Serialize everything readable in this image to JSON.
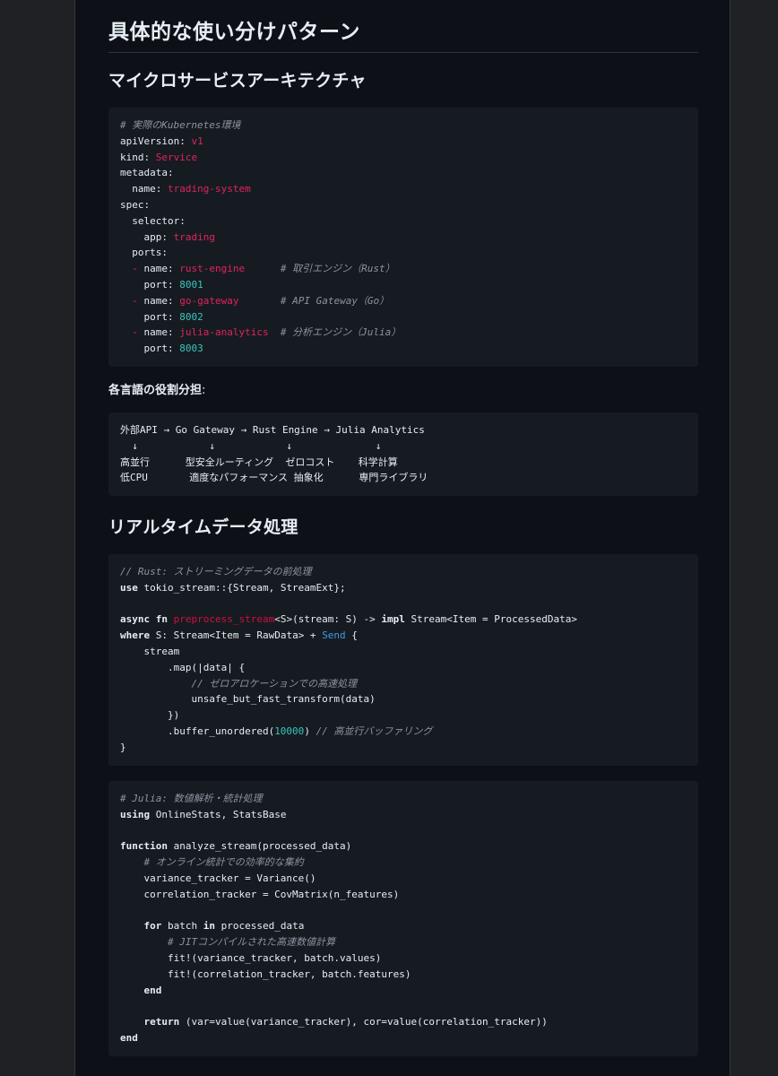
{
  "headings": {
    "h1": "具体的な使い分けパターン",
    "microservices": "マイクロサービスアーキテクチャ",
    "realtime": "リアルタイムデータ処理"
  },
  "roles_label": "各言語の役割分担",
  "roles_label_suffix": ":",
  "code_blocks": [
    {
      "id": "k8s",
      "lines": [
        [
          {
            "t": "cm",
            "v": "# 実際のKubernetes環境"
          }
        ],
        [
          {
            "t": "plain",
            "v": "apiVersion: "
          },
          {
            "t": "str",
            "v": "v1"
          }
        ],
        [
          {
            "t": "plain",
            "v": "kind: "
          },
          {
            "t": "str",
            "v": "Service"
          }
        ],
        [
          {
            "t": "plain",
            "v": "metadata:"
          }
        ],
        [
          {
            "t": "plain",
            "v": "  name: "
          },
          {
            "t": "str",
            "v": "trading-system"
          }
        ],
        [
          {
            "t": "plain",
            "v": "spec:"
          }
        ],
        [
          {
            "t": "plain",
            "v": "  selector:"
          }
        ],
        [
          {
            "t": "plain",
            "v": "    app: "
          },
          {
            "t": "str",
            "v": "trading"
          }
        ],
        [
          {
            "t": "plain",
            "v": "  ports:"
          }
        ],
        [
          {
            "t": "dash",
            "v": "  - "
          },
          {
            "t": "plain",
            "v": "name: "
          },
          {
            "t": "str",
            "v": "rust-engine"
          },
          {
            "t": "plain",
            "v": "      "
          },
          {
            "t": "cm",
            "v": "# 取引エンジン（Rust）"
          }
        ],
        [
          {
            "t": "plain",
            "v": "    port: "
          },
          {
            "t": "num",
            "v": "8001"
          }
        ],
        [
          {
            "t": "dash",
            "v": "  - "
          },
          {
            "t": "plain",
            "v": "name: "
          },
          {
            "t": "str",
            "v": "go-gateway"
          },
          {
            "t": "plain",
            "v": "       "
          },
          {
            "t": "cm",
            "v": "# API Gateway（Go）"
          }
        ],
        [
          {
            "t": "plain",
            "v": "    port: "
          },
          {
            "t": "num",
            "v": "8002"
          }
        ],
        [
          {
            "t": "dash",
            "v": "  - "
          },
          {
            "t": "plain",
            "v": "name: "
          },
          {
            "t": "str",
            "v": "julia-analytics"
          },
          {
            "t": "plain",
            "v": "  "
          },
          {
            "t": "cm",
            "v": "# 分析エンジン（Julia）"
          }
        ],
        [
          {
            "t": "plain",
            "v": "    port: "
          },
          {
            "t": "num",
            "v": "8003"
          }
        ]
      ]
    },
    {
      "id": "roles",
      "lines": [
        [
          {
            "t": "plain",
            "v": "外部API → Go Gateway → Rust Engine → Julia Analytics"
          }
        ],
        [
          {
            "t": "plain",
            "v": "  ↓            ↓            ↓              ↓"
          }
        ],
        [
          {
            "t": "plain",
            "v": "高並行      型安全ルーティング  ゼロコスト    科学計算"
          }
        ],
        [
          {
            "t": "plain",
            "v": "低CPU       適度なパフォーマンス 抽象化      専門ライブラリ"
          }
        ]
      ]
    },
    {
      "id": "rust",
      "lines": [
        [
          {
            "t": "cm",
            "v": "// Rust: ストリーミングデータの前処理"
          }
        ],
        [
          {
            "t": "kw",
            "v": "use"
          },
          {
            "t": "plain",
            "v": " tokio_stream::{Stream, StreamExt};"
          }
        ],
        [],
        [
          {
            "t": "kw",
            "v": "async fn"
          },
          {
            "t": "plain",
            "v": " "
          },
          {
            "t": "fn",
            "v": "preprocess_stream"
          },
          {
            "t": "plain",
            "v": "<S>(stream: S) -> "
          },
          {
            "t": "kw",
            "v": "impl"
          },
          {
            "t": "plain",
            "v": " Stream<Item = ProcessedData>"
          }
        ],
        [
          {
            "t": "kw",
            "v": "where"
          },
          {
            "t": "plain",
            "v": " S: Stream<Item = RawData> + "
          },
          {
            "t": "sv",
            "v": "Send"
          },
          {
            "t": "plain",
            "v": " {"
          }
        ],
        [
          {
            "t": "plain",
            "v": "    stream"
          }
        ],
        [
          {
            "t": "plain",
            "v": "        .map(|data| {"
          }
        ],
        [
          {
            "t": "plain",
            "v": "            "
          },
          {
            "t": "cm",
            "v": "// ゼロアロケーションでの高速処理"
          }
        ],
        [
          {
            "t": "plain",
            "v": "            unsafe_but_fast_transform(data)"
          }
        ],
        [
          {
            "t": "plain",
            "v": "        })"
          }
        ],
        [
          {
            "t": "plain",
            "v": "        .buffer_unordered("
          },
          {
            "t": "num",
            "v": "10000"
          },
          {
            "t": "plain",
            "v": ") "
          },
          {
            "t": "cm",
            "v": "// 高並行バッファリング"
          }
        ],
        [
          {
            "t": "plain",
            "v": "}"
          }
        ]
      ]
    },
    {
      "id": "julia",
      "lines": [
        [
          {
            "t": "cm",
            "v": "# Julia: 数値解析・統計処理"
          }
        ],
        [
          {
            "t": "kw",
            "v": "using"
          },
          {
            "t": "plain",
            "v": " OnlineStats, StatsBase"
          }
        ],
        [],
        [
          {
            "t": "kw",
            "v": "function"
          },
          {
            "t": "plain",
            "v": " analyze_stream(processed_data)"
          }
        ],
        [
          {
            "t": "plain",
            "v": "    "
          },
          {
            "t": "cm",
            "v": "# オンライン統計での効率的な集約"
          }
        ],
        [
          {
            "t": "plain",
            "v": "    variance_tracker = Variance()"
          }
        ],
        [
          {
            "t": "plain",
            "v": "    correlation_tracker = CovMatrix(n_features)"
          }
        ],
        [],
        [
          {
            "t": "plain",
            "v": "    "
          },
          {
            "t": "kw",
            "v": "for"
          },
          {
            "t": "plain",
            "v": " batch "
          },
          {
            "t": "kw",
            "v": "in"
          },
          {
            "t": "plain",
            "v": " processed_data"
          }
        ],
        [
          {
            "t": "plain",
            "v": "        "
          },
          {
            "t": "cm",
            "v": "# JITコンパイルされた高速数値計算"
          }
        ],
        [
          {
            "t": "plain",
            "v": "        fit!(variance_tracker, batch.values)"
          }
        ],
        [
          {
            "t": "plain",
            "v": "        fit!(correlation_tracker, batch.features)"
          }
        ],
        [
          {
            "t": "plain",
            "v": "    "
          },
          {
            "t": "kw",
            "v": "end"
          }
        ],
        [],
        [
          {
            "t": "plain",
            "v": "    "
          },
          {
            "t": "kw",
            "v": "return"
          },
          {
            "t": "plain",
            "v": " (var=value(variance_tracker), cor=value(correlation_tracker))"
          }
        ],
        [
          {
            "t": "kw",
            "v": "end"
          }
        ]
      ]
    }
  ]
}
